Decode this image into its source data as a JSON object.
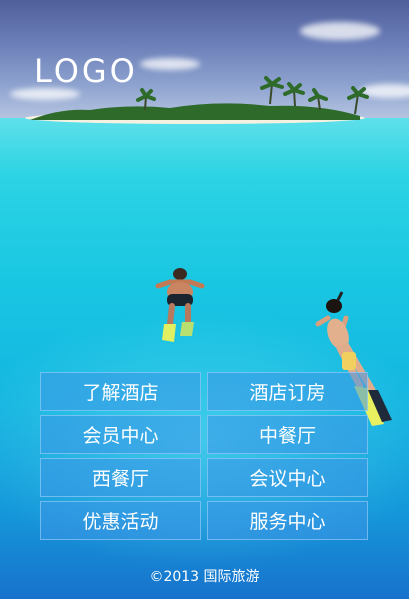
{
  "header": {
    "logo_text": "LOGO"
  },
  "menu": {
    "items": [
      {
        "label": "了解酒店"
      },
      {
        "label": "酒店订房"
      },
      {
        "label": "会员中心"
      },
      {
        "label": "中餐厅"
      },
      {
        "label": "西餐厅"
      },
      {
        "label": "会议中心"
      },
      {
        "label": "优惠活动"
      },
      {
        "label": "服务中心"
      }
    ]
  },
  "footer": {
    "copyright": "©2013 国际旅游"
  },
  "colors": {
    "sea": "#18c6e2",
    "sky": "#5b6ca6",
    "button": "#3c96e6"
  }
}
